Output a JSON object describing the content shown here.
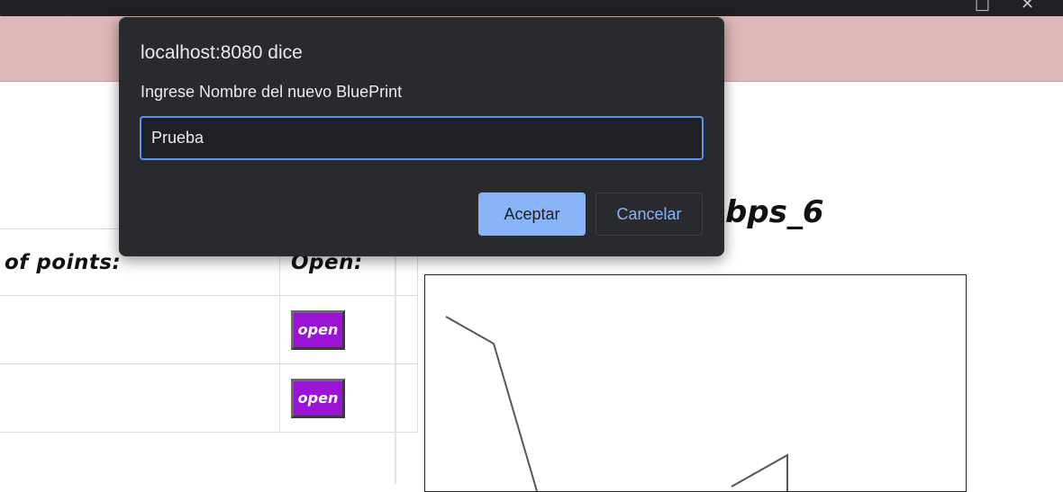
{
  "dialog": {
    "origin": "localhost:8080 dice",
    "message": "Ingrese Nombre del nuevo BluePrint",
    "input_value": "Prueba",
    "accept_label": "Aceptar",
    "cancel_label": "Cancelar"
  },
  "table": {
    "col_points_header": "of points:",
    "col_open_header": "Open:",
    "rows": [
      {
        "open_label": "open"
      },
      {
        "open_label": "open"
      }
    ]
  },
  "canvas": {
    "title": "bps_6"
  },
  "colors": {
    "header_bg": "#deb7b7",
    "open_button": "#9b14d6",
    "dialog_bg": "#292a2d",
    "accent": "#8ab4f8"
  },
  "icons": [
    "maximize-icon",
    "close-icon"
  ]
}
